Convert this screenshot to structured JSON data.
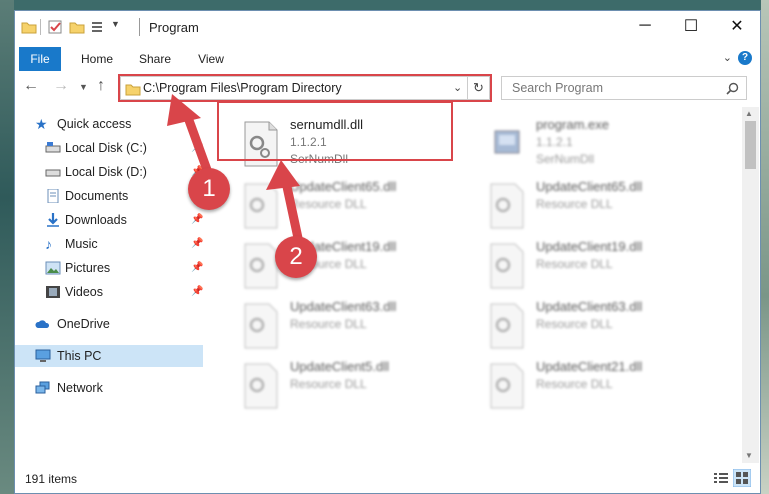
{
  "window": {
    "title": "Program",
    "minimize": "─",
    "maximize": "☐",
    "close": "✕"
  },
  "ribbon": {
    "tabs": [
      "File",
      "Home",
      "Share",
      "View"
    ],
    "help": "?"
  },
  "address": {
    "path": "C:\\Program Files\\Program Directory"
  },
  "search": {
    "placeholder": "Search Program"
  },
  "sidebar": {
    "items": [
      {
        "label": "Quick access",
        "icon": "star-icon"
      },
      {
        "label": "Local Disk (C:)",
        "icon": "drive-icon"
      },
      {
        "label": "Local Disk (D:)",
        "icon": "drive-icon"
      },
      {
        "label": "Documents",
        "icon": "documents-icon"
      },
      {
        "label": "Downloads",
        "icon": "downloads-icon"
      },
      {
        "label": "Music",
        "icon": "music-icon"
      },
      {
        "label": "Pictures",
        "icon": "pictures-icon"
      },
      {
        "label": "Videos",
        "icon": "videos-icon"
      },
      {
        "label": "OneDrive",
        "icon": "onedrive-icon"
      },
      {
        "label": "This PC",
        "icon": "pc-icon"
      },
      {
        "label": "Network",
        "icon": "network-icon"
      }
    ]
  },
  "files": [
    {
      "name": "sernumdll.dll",
      "line1": "1.1.2.1",
      "line2": "SerNumDll"
    },
    {
      "name": "program.exe",
      "line1": "1.1.2.1",
      "line2": "SerNumDll"
    },
    {
      "name": "UpdateClient65.dll",
      "line1": "Resource DLL"
    },
    {
      "name": "UpdateClient65.dll",
      "line1": "Resource DLL"
    },
    {
      "name": "UpdateClient19.dll",
      "line1": "Resource DLL"
    },
    {
      "name": "UpdateClient19.dll",
      "line1": "Resource DLL"
    },
    {
      "name": "UpdateClient63.dll",
      "line1": "Resource DLL"
    },
    {
      "name": "UpdateClient63.dll",
      "line1": "Resource DLL"
    },
    {
      "name": "UpdateClient5.dll",
      "line1": "Resource DLL"
    },
    {
      "name": "UpdateClient21.dll",
      "line1": "Resource DLL"
    }
  ],
  "status": {
    "count": "191 items"
  },
  "annotations": {
    "step1": "1",
    "step2": "2",
    "color": "#d9454a"
  }
}
